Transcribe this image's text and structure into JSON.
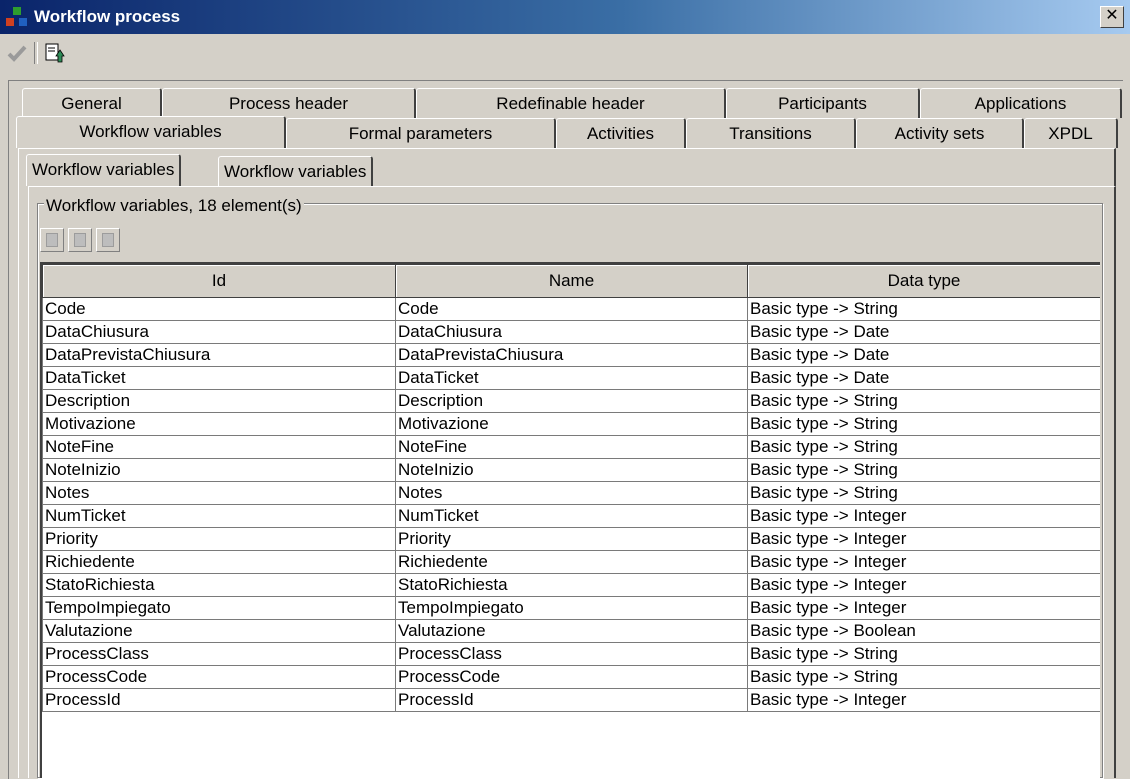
{
  "window": {
    "title": "Workflow process",
    "close_label": "✕"
  },
  "toolbar": {
    "items": [
      {
        "icon": "checkmark-icon",
        "enabled": false
      },
      {
        "icon": "export-icon",
        "enabled": true
      }
    ]
  },
  "tabs": {
    "row1": [
      "General",
      "Process header",
      "Redefinable header",
      "Participants",
      "Applications"
    ],
    "row2": [
      "Workflow variables",
      "Formal parameters",
      "Activities",
      "Transitions",
      "Activity sets",
      "XPDL"
    ],
    "active": "Workflow variables"
  },
  "subtabs": [
    "Workflow variables",
    "Workflow variables"
  ],
  "group": {
    "label": "Workflow variables, 18 element(s)"
  },
  "mini_toolbar": [
    "new-icon",
    "edit-icon",
    "delete-icon"
  ],
  "table": {
    "headers": [
      "Id",
      "Name",
      "Data type"
    ],
    "rows": [
      [
        "Code",
        "Code",
        "Basic type -> String"
      ],
      [
        "DataChiusura",
        "DataChiusura",
        "Basic type -> Date"
      ],
      [
        "DataPrevistaChiusura",
        "DataPrevistaChiusura",
        "Basic type -> Date"
      ],
      [
        "DataTicket",
        "DataTicket",
        "Basic type -> Date"
      ],
      [
        "Description",
        "Description",
        "Basic type -> String"
      ],
      [
        "Motivazione",
        "Motivazione",
        "Basic type -> String"
      ],
      [
        "NoteFine",
        "NoteFine",
        "Basic type -> String"
      ],
      [
        "NoteInizio",
        "NoteInizio",
        "Basic type -> String"
      ],
      [
        "Notes",
        "Notes",
        "Basic type -> String"
      ],
      [
        "NumTicket",
        "NumTicket",
        "Basic type -> Integer"
      ],
      [
        "Priority",
        "Priority",
        "Basic type -> Integer"
      ],
      [
        "Richiedente",
        "Richiedente",
        "Basic type -> Integer"
      ],
      [
        "StatoRichiesta",
        "StatoRichiesta",
        "Basic type -> Integer"
      ],
      [
        "TempoImpiegato",
        "TempoImpiegato",
        "Basic type -> Integer"
      ],
      [
        "Valutazione",
        "Valutazione",
        "Basic type -> Boolean"
      ],
      [
        "ProcessClass",
        "ProcessClass",
        "Basic type -> String"
      ],
      [
        "ProcessCode",
        "ProcessCode",
        "Basic type -> String"
      ],
      [
        "ProcessId",
        "ProcessId",
        "Basic type -> Integer"
      ]
    ]
  }
}
